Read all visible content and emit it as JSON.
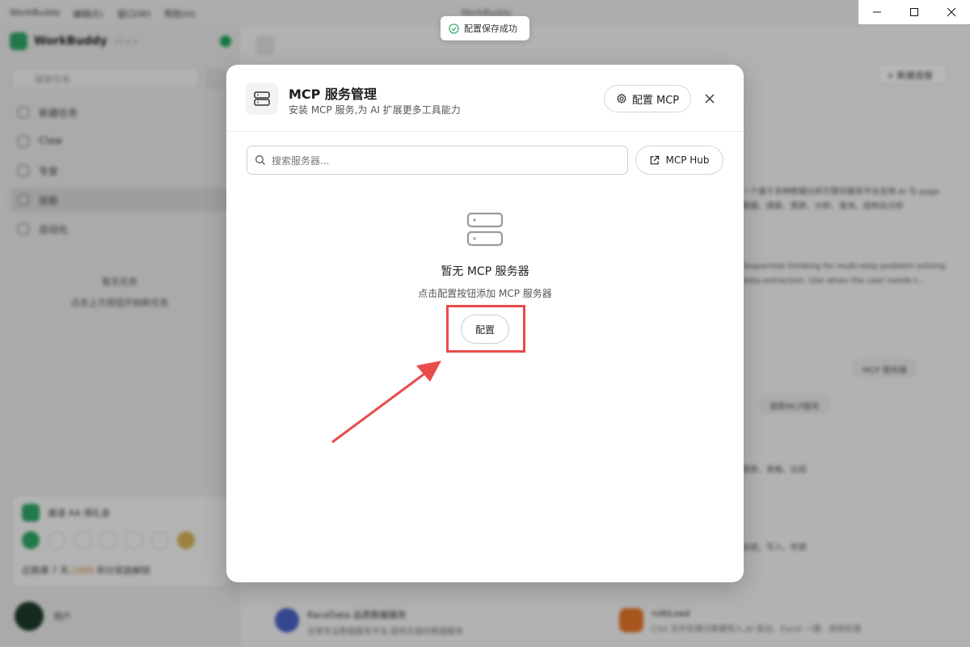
{
  "background": {
    "menu": [
      "WorkBuddy",
      "编辑(E)",
      "窗口(W)",
      "帮助(H)"
    ],
    "window_title": "WorkBuddy",
    "brand": {
      "name": "WorkBuddy",
      "version": "v2.x.x"
    },
    "search_placeholder": "搜索任务",
    "nav": [
      "新建任务",
      "Claw",
      "专家",
      "技能",
      "自动化"
    ],
    "empty": {
      "title": "暂无任务",
      "desc": "点击上方按钮开始新任务"
    },
    "invite": {
      "title": "邀请 AA 得礼金",
      "tip_prefix": "近期满 7 天,",
      "tip_highlight": "1000",
      "tip_suffix": " 积分奖励解锁"
    },
    "user_name": "用户",
    "main": {
      "new_button": "+ 新建连接",
      "mcp_market": "MCP 服务器",
      "chip": "搜索MCP服务",
      "texts": [
        "一个基于多种数据分析引擎的服务平台支持 AI 与 page",
        "数据、搜索、图表、分析、查询、结构化分析",
        "Sequential thinking for multi-step problem-solving",
        "data extraction. Use when the user needs t...",
        "图表、表格、比较",
        "总结、写入、检索"
      ],
      "bottom_cards": [
        {
          "title": "RaceData 品质数据服务",
          "desc": "全球专业数据服务平台,提供全面的数据服务"
        },
        {
          "title": "ndbLoad",
          "desc": "CSV 文件处理与数据导入,AI 驱动、Excel 一键、高效处理"
        }
      ]
    }
  },
  "toast": {
    "text": "配置保存成功"
  },
  "modal": {
    "title": "MCP 服务管理",
    "subtitle": "安装 MCP 服务,为 AI 扩展更多工具能力",
    "configure_mcp_button": "配置 MCP",
    "search_placeholder": "搜索服务器...",
    "hub_button": "MCP Hub",
    "empty_title": "暂无 MCP 服务器",
    "empty_desc": "点击配置按钮添加 MCP 服务器",
    "configure_button": "配置"
  },
  "colors": {
    "annotation": "#e94b4b",
    "success": "#2ea866"
  }
}
